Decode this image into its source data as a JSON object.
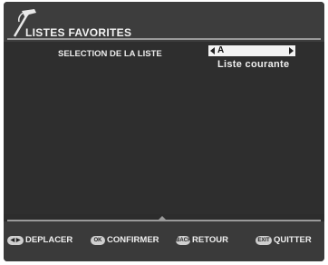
{
  "header": {
    "title": "LISTES FAVORITES",
    "logo_icon": "hammer-icon"
  },
  "selection": {
    "label": "SELECTION DE LA LISTE",
    "value": "A",
    "caption": "Liste courante"
  },
  "footer": {
    "items": [
      {
        "key": "◀ ▶",
        "label": "DEPLACER"
      },
      {
        "key": "OK",
        "label": "CONFIRMER"
      },
      {
        "key": "BACK",
        "label": "RETOUR"
      },
      {
        "key": "EXIT",
        "label": "QUITTER"
      }
    ]
  },
  "colors": {
    "background": "#2c2c2c",
    "text": "#f0f0f0",
    "selector": "#f2f2f2"
  }
}
